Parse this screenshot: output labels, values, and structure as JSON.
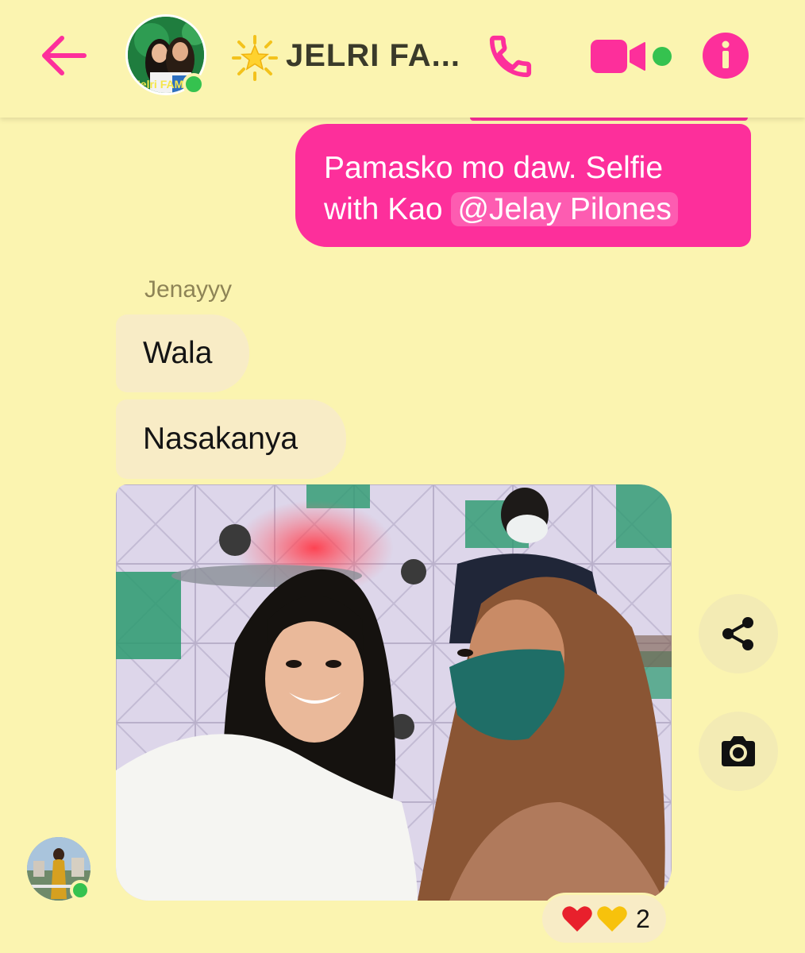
{
  "header": {
    "title": "JELRI FA...",
    "title_emoji_icon": "star-icon",
    "back_icon": "arrow-left-icon",
    "call_icon": "phone-icon",
    "video_icon": "video-camera-icon",
    "info_icon": "info-icon",
    "accent_color": "#fd2f9b",
    "avatar_text": "Jelri FAMILY",
    "online": true
  },
  "messages": [
    {
      "direction": "outgoing",
      "text": "Pamasko mo daw. Selfie with Kao",
      "mention": "@Jelay Pilones"
    },
    {
      "direction": "incoming",
      "sender": "Jenayyy",
      "text": "Wala"
    },
    {
      "direction": "incoming",
      "text": "Nasakanya"
    },
    {
      "direction": "incoming",
      "type": "photo",
      "reactions": {
        "icons": [
          "red-heart-icon",
          "yellow-heart-icon"
        ],
        "count": "2"
      }
    }
  ],
  "photo_actions": [
    "share-icon",
    "camera-icon"
  ],
  "colors": {
    "background": "#fbf4b0",
    "incoming_bubble": "#f8ecc6",
    "outgoing_bubble": "#fd2f9b",
    "online": "#35c24f"
  }
}
